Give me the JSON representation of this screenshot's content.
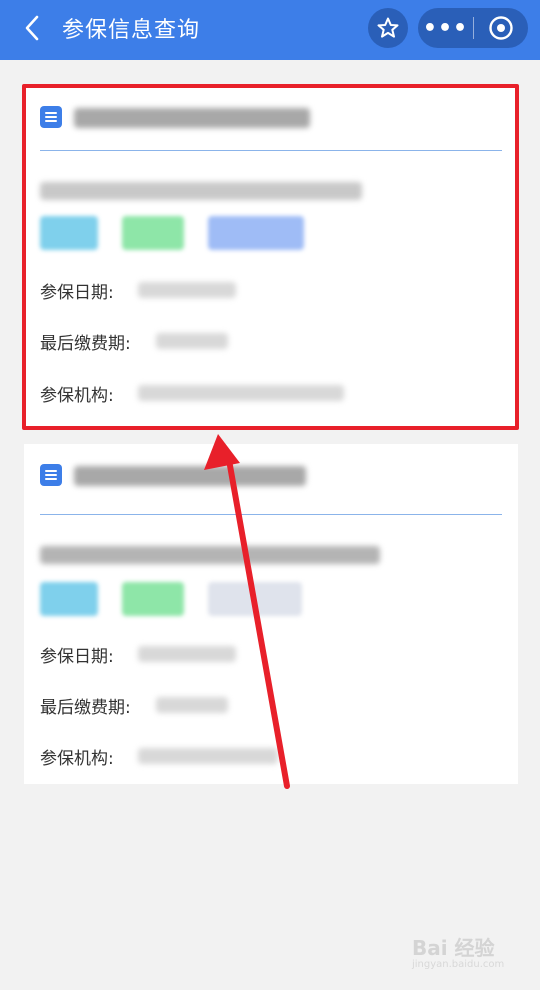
{
  "header": {
    "title": "参保信息查询",
    "back_icon": "chevron-left-icon",
    "favorite_icon": "star-icon",
    "more_icon": "more-dots-icon",
    "close_icon": "target-circle-icon",
    "background_color": "#3d7ee8"
  },
  "cards": [
    {
      "fields": [
        {
          "label": "参保日期:"
        },
        {
          "label": "最后缴费期:"
        },
        {
          "label": "参保机构:"
        }
      ],
      "highlighted": true
    },
    {
      "fields": [
        {
          "label": "参保日期:"
        },
        {
          "label": "最后缴费期:"
        },
        {
          "label": "参保机构:"
        }
      ],
      "highlighted": false
    }
  ],
  "annotation": {
    "highlight_color": "#e8202a"
  },
  "watermark": {
    "brand": "Bai 经验",
    "url": "jingyan.baidu.com"
  }
}
